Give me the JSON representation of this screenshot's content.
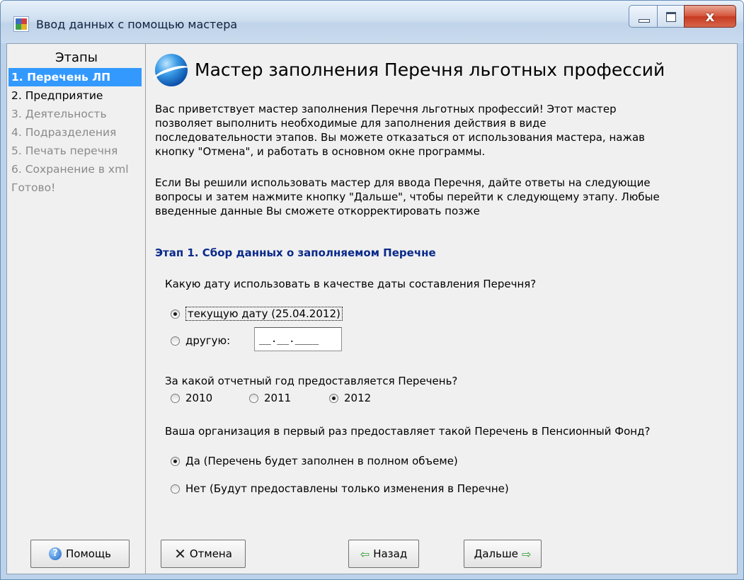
{
  "window": {
    "title": "Ввод данных с помощью мастера",
    "controls": {
      "minimize": "minimize-icon",
      "maximize": "maximize-icon",
      "close": "x"
    }
  },
  "sidebar": {
    "heading": "Этапы",
    "steps": [
      {
        "label": "1. Перечень ЛП",
        "state": "active"
      },
      {
        "label": "2. Предприятие",
        "state": "enabled"
      },
      {
        "label": "3. Деятельность",
        "state": "disabled"
      },
      {
        "label": "4. Подразделения",
        "state": "disabled"
      },
      {
        "label": "5. Печать перечня",
        "state": "disabled"
      },
      {
        "label": "6. Сохранение в xml",
        "state": "disabled"
      },
      {
        "label": "Готово!",
        "state": "disabled"
      }
    ],
    "help_button": {
      "label": "Помощь",
      "icon": "?"
    }
  },
  "main": {
    "title": "Мастер заполнения Перечня льготных профессий",
    "intro_p1": "Вас приветствует мастер заполнения Перечня льготных профессий! Этот мастер позволяет выполнить необходимые для заполнения действия в виде последовательности этапов. Вы можете отказаться от использования мастера, нажав кнопку \"Отмена\", и работать в основном окне программы.",
    "intro_p2": "Если Вы решили использовать мастер для ввода Перечня, дайте ответы на следующие вопросы и затем нажмите кнопку \"Дальше\", чтобы перейти к следующему этапу. Любые введенные данные Вы сможете откорректировать позже",
    "stage_title": "Этап 1. Сбор данных о заполняемом Перечне",
    "q1": {
      "text": "Какую дату использовать в качестве даты составления Перечня?",
      "option_current": "текущую дату (25.04.2012)",
      "option_other": "другую:",
      "date_value": "__.__.____",
      "selected": "current"
    },
    "q2": {
      "text": "За какой отчетный год предоставляется Перечень?",
      "years": [
        "2010",
        "2011",
        "2012"
      ],
      "selected": "2012"
    },
    "q3": {
      "text": "Ваша организация в первый раз предоставляет такой Перечень в Пенсионный Фонд?",
      "option_yes": "Да (Перечень будет заполнен в полном объеме)",
      "option_no": "Нет (Будут предоставлены только изменения в Перечне)",
      "selected": "yes"
    },
    "buttons": {
      "cancel": "Отмена",
      "back": "Назад",
      "next": "Дальше",
      "cancel_icon": "✕",
      "back_icon": "⇦",
      "next_icon": "⇨"
    }
  }
}
